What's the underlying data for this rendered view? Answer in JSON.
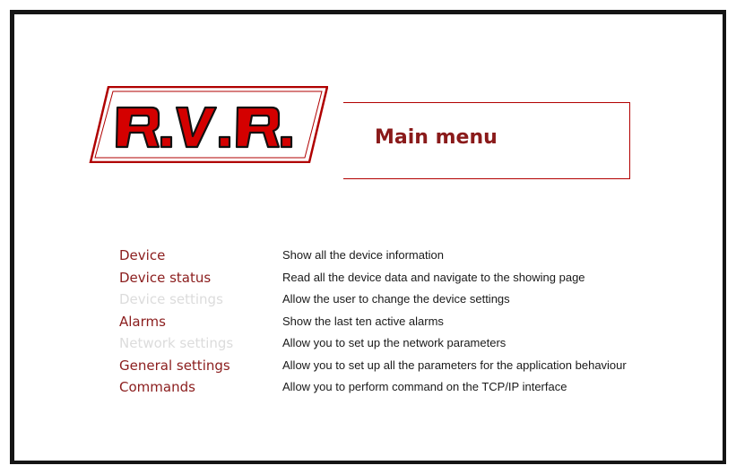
{
  "page": {
    "title": "Main menu",
    "logo_text": "R.V.R."
  },
  "colors": {
    "accent": "#8b1d1d",
    "logo_red": "#b00000",
    "disabled": "#dcdcdc",
    "frame": "#151515"
  },
  "menu": {
    "items": [
      {
        "label": "Device",
        "description": "Show all the device information",
        "enabled": true
      },
      {
        "label": "Device status",
        "description": "Read all the device data and navigate to the showing page",
        "enabled": true
      },
      {
        "label": "Device settings",
        "description": "Allow the user to change the device settings",
        "enabled": false
      },
      {
        "label": "Alarms",
        "description": "Show the last ten active alarms",
        "enabled": true
      },
      {
        "label": "Network settings",
        "description": "Allow you to set up the network parameters",
        "enabled": false
      },
      {
        "label": "General settings",
        "description": "Allow you to set up all the parameters for the application behaviour",
        "enabled": true
      },
      {
        "label": "Commands",
        "description": "Allow you to perform command on the TCP/IP interface",
        "enabled": true
      }
    ]
  }
}
